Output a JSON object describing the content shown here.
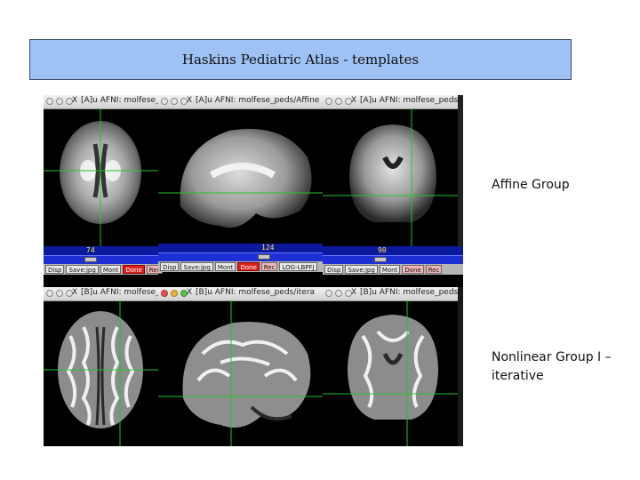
{
  "header": {
    "title": "Haskins Pediatric Atlas - templates"
  },
  "labels": {
    "affine": "Affine Group",
    "nonlinear_line1": "Nonlinear Group I –",
    "nonlinear_line2": "iterative"
  },
  "top_row": {
    "windows": [
      {
        "title": "[A]u AFNI: molfese_"
      },
      {
        "title": "[A]u AFNI: molfese_peds/Affine"
      },
      {
        "title": "[A]u AFNI: molfese_peds"
      }
    ],
    "slider_values": [
      "74",
      "124",
      "90"
    ],
    "buttons_left": [
      "Disp",
      "Save:jpg",
      "Mont",
      "Done",
      "Rec"
    ],
    "buttons_mid": [
      "Disp",
      "Save:jpg",
      "Mont",
      "Done",
      "Rec"
    ],
    "buttons_right": [
      "Disp",
      "Save:jpg",
      "Mont",
      "Done",
      "Rec"
    ],
    "mid_extra": "LOG-LBPFJ"
  },
  "bottom_row": {
    "windows": [
      {
        "title": "[B]u AFNI: molfese_"
      },
      {
        "title": "[B]u AFNI: molfese_peds/itera"
      },
      {
        "title": "[B]u AFNI: molfese_peds."
      }
    ]
  },
  "colors": {
    "crosshair": "#22c42a",
    "header_bg": "#9fc2f5",
    "afni_slider": "#1f2fd6"
  }
}
